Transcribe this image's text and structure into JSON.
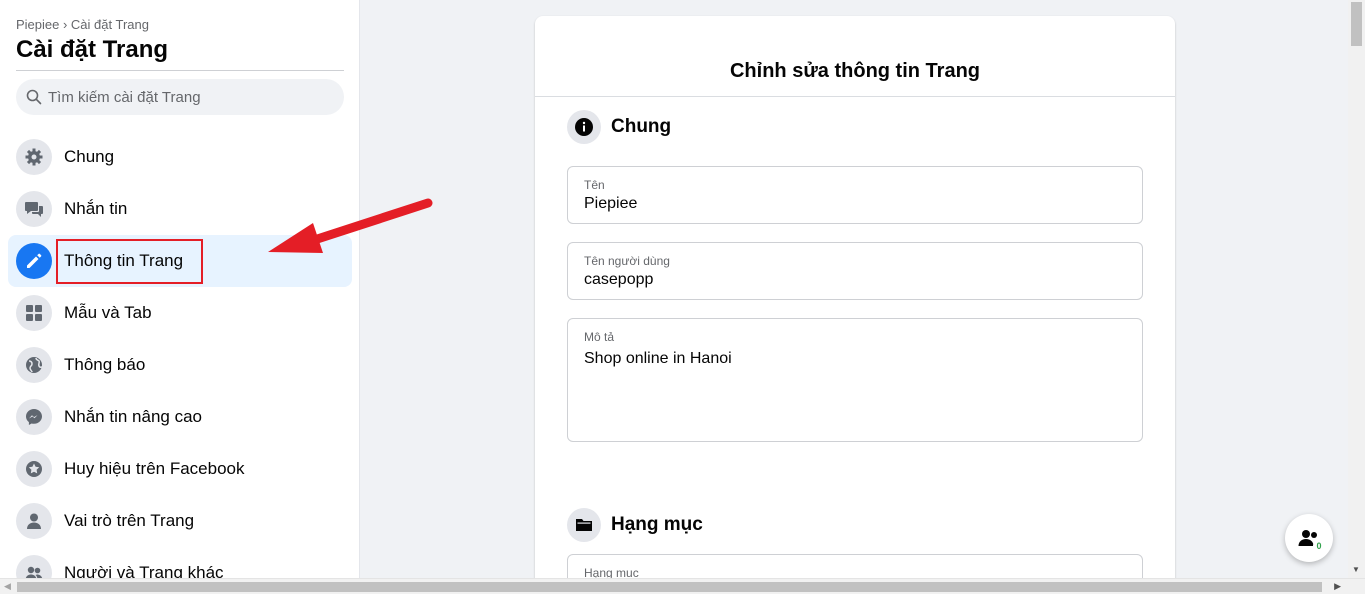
{
  "sidebar": {
    "breadcrumb": "Piepiee › Cài đặt Trang",
    "title": "Cài đặt Trang",
    "search_placeholder": "Tìm kiếm cài đặt Trang",
    "items": [
      {
        "label": "Chung",
        "icon": "gear-icon"
      },
      {
        "label": "Nhắn tin",
        "icon": "chat-bubbles-icon"
      },
      {
        "label": "Thông tin Trang",
        "icon": "pencil-icon",
        "active": true
      },
      {
        "label": "Mẫu và Tab",
        "icon": "grid-icon"
      },
      {
        "label": "Thông báo",
        "icon": "globe-icon"
      },
      {
        "label": "Nhắn tin nâng cao",
        "icon": "messenger-icon"
      },
      {
        "label": "Huy hiệu trên Facebook",
        "icon": "star-badge-icon"
      },
      {
        "label": "Vai trò trên Trang",
        "icon": "person-icon"
      },
      {
        "label": "Người và Trang khác",
        "icon": "people-icon"
      }
    ]
  },
  "main": {
    "title": "Chỉnh sửa thông tin Trang",
    "section_general": "Chung",
    "fields": {
      "name": {
        "label": "Tên",
        "value": "Piepiee"
      },
      "username": {
        "label": "Tên người dùng",
        "value": "casepopp"
      },
      "description": {
        "label": "Mô tả",
        "value": "Shop online in Hanoi"
      }
    },
    "section_category": "Hạng mục",
    "category_field_label": "Hạng mục"
  },
  "fab": {
    "badge": "0"
  },
  "colors": {
    "accent": "#1877f2",
    "highlight": "#e41e26",
    "active_bg": "#e7f3ff"
  }
}
